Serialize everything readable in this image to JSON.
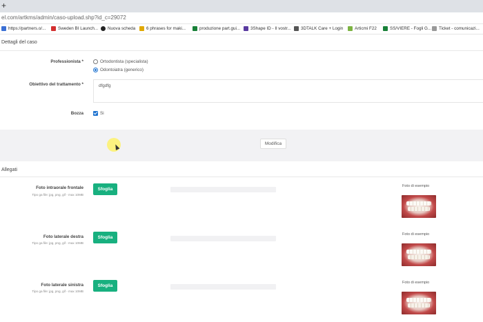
{
  "browser": {
    "new_tab_symbol": "+",
    "url": "el.com/artkms/admin/caso-upload.shp?id_c=29072",
    "bookmarks": [
      {
        "label": "https://partners.o/...",
        "color": "#3b6fd4"
      },
      {
        "label": "Sweden BI Launch...",
        "color": "#d32f2f"
      },
      {
        "label": "Nuova scheda",
        "color": "#222222"
      },
      {
        "label": "6 phrases for maki...",
        "color": "#e0a800"
      },
      {
        "label": "produzione part.gui...",
        "color": "#188038"
      },
      {
        "label": "3Shape ID - Il vostr...",
        "color": "#5a3ba0"
      },
      {
        "label": "3DTALK Care + Login",
        "color": "#555555"
      },
      {
        "label": "Articmi F22",
        "color": "#7cb342"
      },
      {
        "label": "SS/VIERE - Fogli G...",
        "color": "#188038"
      },
      {
        "label": "Ticket - comunicazi...",
        "color": "#999999"
      }
    ]
  },
  "details": {
    "title": "Dettagli del caso",
    "professional_label": "Professionista *",
    "option_ortho": "Ortodontista (specialista)",
    "option_dentist": "Odontoiatra (generico)",
    "selected_option": "Odontoiatra (generico)",
    "treatment_label": "Obiettivo del trattamento *",
    "treatment_value": "dfgdfg",
    "bozza_label": "Bozza",
    "bozza_value": "Si",
    "bozza_checked": true,
    "modify_button": "Modifica"
  },
  "attachments": {
    "title": "Allegati",
    "upload_button": "Sfoglia",
    "example_label": "Foto di esempio",
    "hint": "Tipo ga file: jpg, png, gif - max 10MB",
    "items": [
      {
        "label": "Foto intraorale frontale"
      },
      {
        "label": "Foto laterale destra"
      },
      {
        "label": "Foto laterale sinistra"
      }
    ]
  },
  "colors": {
    "accent_green": "#18b07f",
    "radio_blue": "#1f73d0"
  }
}
